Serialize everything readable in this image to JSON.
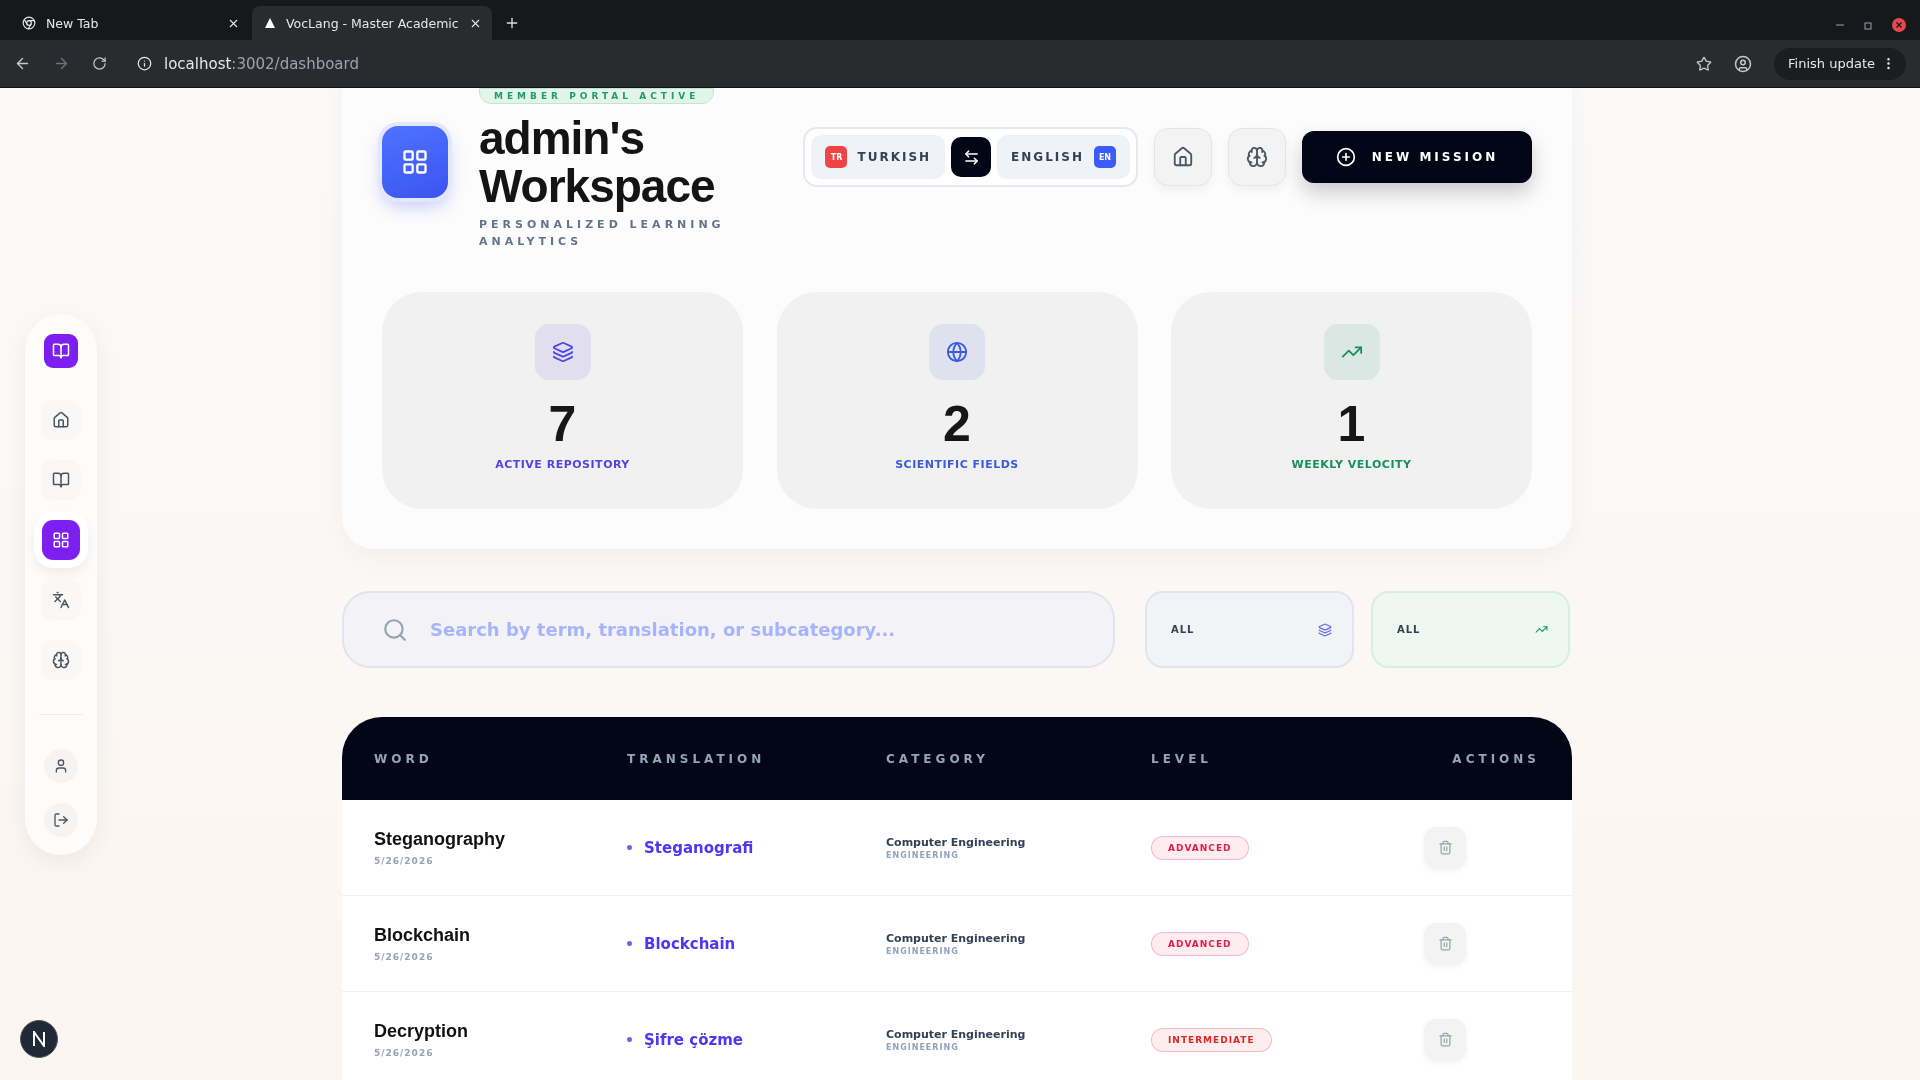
{
  "browser": {
    "tabs": [
      {
        "title": "New Tab",
        "selected": false
      },
      {
        "title": "VocLang - Master Academic",
        "selected": true
      }
    ],
    "address": {
      "host": "localhost",
      "path": ":3002/dashboard"
    },
    "update_button": "Finish update"
  },
  "sidebar": {
    "items": [
      {
        "selected": false
      },
      {
        "selected": false
      },
      {
        "selected": true
      },
      {
        "selected": false
      },
      {
        "selected": false
      }
    ]
  },
  "header": {
    "badge": "MEMBER PORTAL ACTIVE",
    "title": "admin's Workspace",
    "subtitle": "PERSONALIZED LEARNING ANALYTICS",
    "source_language": {
      "code": "TR",
      "name": "TURKISH"
    },
    "target_language": {
      "code": "EN",
      "name": "ENGLISH"
    },
    "new_mission": "NEW MISSION"
  },
  "stats": [
    {
      "value": "7",
      "label": "ACTIVE REPOSITORY",
      "color": "#4f46e5"
    },
    {
      "value": "2",
      "label": "SCIENTIFIC FIELDS",
      "color": "#3b5bdb"
    },
    {
      "value": "1",
      "label": "WEEKLY VELOCITY",
      "color": "#15915f"
    }
  ],
  "search": {
    "placeholder": "Search by term, translation, or subcategory..."
  },
  "filters": [
    {
      "value": "ALL"
    },
    {
      "value": "ALL"
    }
  ],
  "table": {
    "columns": [
      "WORD",
      "TRANSLATION",
      "CATEGORY",
      "LEVEL",
      "ACTIONS"
    ],
    "rows": [
      {
        "word": "Steganography",
        "date": "5/26/2026",
        "translation": "Steganografi",
        "category": "Computer Engineering",
        "subcategory": "ENGINEERING",
        "level": "ADVANCED",
        "color": "#e11d48"
      },
      {
        "word": "Blockchain",
        "date": "5/26/2026",
        "translation": "Blockchain",
        "category": "Computer Engineering",
        "subcategory": "ENGINEERING",
        "level": "ADVANCED",
        "color": "#e11d48"
      },
      {
        "word": "Decryption",
        "date": "5/26/2026",
        "translation": "Şifre çözme",
        "category": "Computer Engineering",
        "subcategory": "ENGINEERING",
        "level": "INTERMEDIATE",
        "color": "#dc2626"
      }
    ]
  }
}
